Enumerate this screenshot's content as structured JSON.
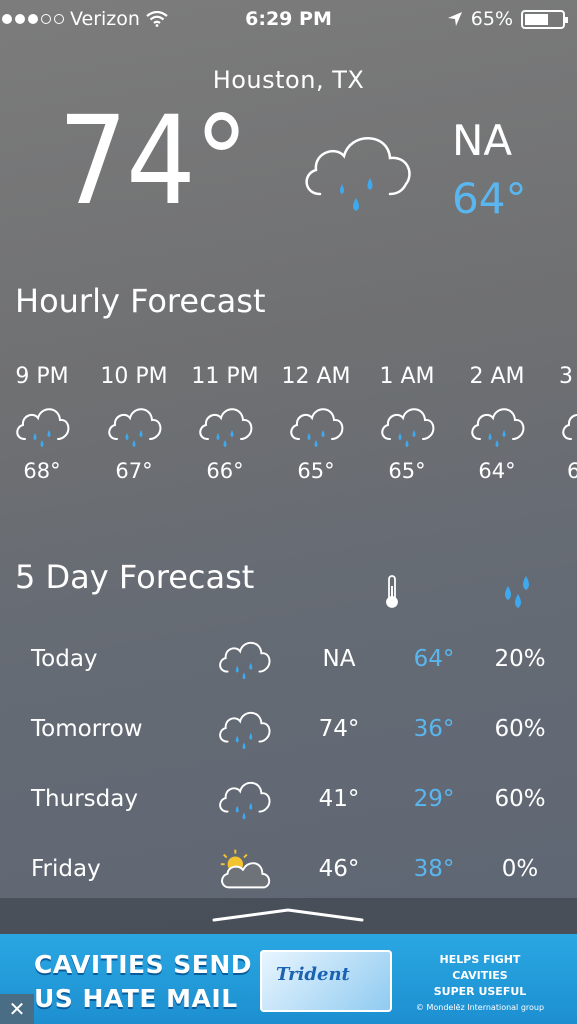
{
  "status": {
    "carrier": "Verizon",
    "time": "6:29 PM",
    "battery": "65%",
    "battery_level": 0.65
  },
  "current": {
    "city": "Houston, TX",
    "temp": "74°",
    "hi": "NA",
    "lo": "64°",
    "icon": "rain-cloud-icon"
  },
  "hourly": {
    "title": "Hourly Forecast",
    "items": [
      {
        "time": "9 PM",
        "temp": "68°"
      },
      {
        "time": "10 PM",
        "temp": "67°"
      },
      {
        "time": "11 PM",
        "temp": "66°"
      },
      {
        "time": "12 AM",
        "temp": "65°"
      },
      {
        "time": "1 AM",
        "temp": "65°"
      },
      {
        "time": "2 AM",
        "temp": "64°"
      },
      {
        "time": "3",
        "temp": "6"
      }
    ]
  },
  "five_day": {
    "title": "5 Day Forecast",
    "rows": [
      {
        "day": "Today",
        "hi": "NA",
        "lo": "64°",
        "pop": "20%",
        "icon": "rain-cloud-icon"
      },
      {
        "day": "Tomorrow",
        "hi": "74°",
        "lo": "36°",
        "pop": "60%",
        "icon": "rain-cloud-icon"
      },
      {
        "day": "Thursday",
        "hi": "41°",
        "lo": "29°",
        "pop": "60%",
        "icon": "rain-cloud-icon"
      },
      {
        "day": "Friday",
        "hi": "46°",
        "lo": "38°",
        "pop": "0%",
        "icon": "partly-sunny-icon"
      }
    ]
  },
  "ad": {
    "line1": "CAVITIES SEND",
    "line2": "US HATE MAIL",
    "brand": "Trident",
    "tag1": "HELPS FIGHT CAVITIES",
    "tag2": "SUPER USEFUL",
    "tag3": "© Mondelēz International group",
    "close": "✕"
  },
  "colors": {
    "accent": "#5ab6ef",
    "ad_bg": "#2aa7e3"
  }
}
